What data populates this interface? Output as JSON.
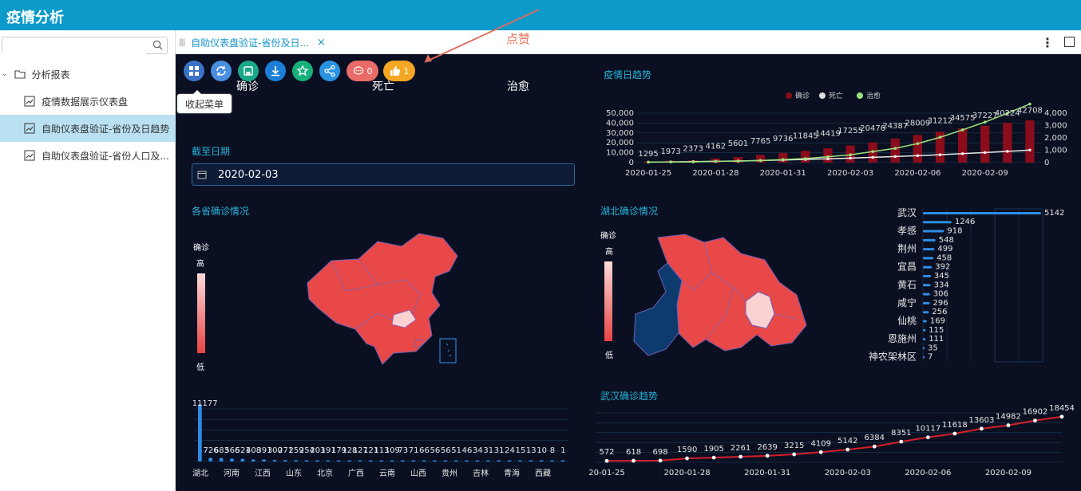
{
  "app": {
    "title": "疫情分析"
  },
  "sidebar": {
    "search_placeholder": "",
    "items": [
      {
        "label": "分析报表"
      },
      {
        "label": "疫情数据展示仪表盘"
      },
      {
        "label": "自助仪表盘验证-省份及日趋势"
      },
      {
        "label": "自助仪表盘验证-省份人口及..."
      }
    ]
  },
  "tabs": [
    {
      "label": "自助仪表盘验证-省份及日..."
    }
  ],
  "annotation": {
    "text": "点赞"
  },
  "toolbar": {
    "comment_count": "0",
    "like_count": "1",
    "tooltip": "收起菜单"
  },
  "colors": {
    "accent": "#0b9ac9",
    "dash_bg": "#0a1021",
    "title": "#27b2d8",
    "bar_red": "#8b0d1c",
    "map_red": "#e84848",
    "line_green": "#9be27c"
  },
  "kpis": {
    "confirmed": "确诊",
    "deaths": "死亡",
    "cured": "治愈"
  },
  "date_filter": {
    "label": "截至日期",
    "value": "2020-02-03"
  },
  "panels": {
    "province_map": {
      "title": "各省确诊情况",
      "legend_title": "确诊",
      "legend_high": "高",
      "legend_low": "低"
    },
    "daily_trend": {
      "title": "疫情日趋势"
    },
    "hubei_map": {
      "title": "湖北确诊情况",
      "legend_title": "确诊",
      "legend_high": "高",
      "legend_low": "低"
    },
    "wuhan_trend": {
      "title": "武汉确诊趋势"
    }
  },
  "chart_data": [
    {
      "type": "bar",
      "id": "daily_trend",
      "title": "疫情日趋势",
      "x": [
        "2020-01-25",
        "2020-01-26",
        "2020-01-27",
        "2020-01-28",
        "2020-01-29",
        "2020-01-30",
        "2020-01-31",
        "2020-02-01",
        "2020-02-02",
        "2020-02-03",
        "2020-02-04",
        "2020-02-05",
        "2020-02-06",
        "2020-02-07",
        "2020-02-08",
        "2020-02-09",
        "2020-02-10",
        "2020-02-11"
      ],
      "x_tick_labels": [
        "2020-01-25",
        "2020-01-28",
        "2020-01-31",
        "2020-02-03",
        "2020-02-06",
        "2020-02-09"
      ],
      "series": [
        {
          "name": "确诊",
          "axis": "left",
          "values": [
            1295,
            1973,
            2373,
            4162,
            5601,
            7765,
            9736,
            11845,
            14419,
            17255,
            20476,
            24387,
            28009,
            31212,
            34575,
            37227,
            40224,
            42708
          ]
        },
        {
          "name": "死亡",
          "axis": "right",
          "values": [
            41,
            56,
            80,
            106,
            132,
            170,
            213,
            259,
            304,
            361,
            425,
            490,
            563,
            636,
            722,
            811,
            908,
            1016
          ]
        },
        {
          "name": "治愈",
          "axis": "right",
          "values": [
            38,
            51,
            60,
            103,
            124,
            171,
            243,
            328,
            475,
            632,
            892,
            1153,
            1540,
            2050,
            2649,
            3281,
            3996,
            4740
          ]
        }
      ],
      "left_axis_ticks": [
        "0",
        "10,000",
        "20,000",
        "30,000",
        "40,000",
        "50,000"
      ],
      "right_axis_ticks": [
        "0",
        "1,000",
        "2,000",
        "3,000",
        "4,000"
      ],
      "ylim_left": [
        0,
        50000
      ],
      "ylim_right": [
        0,
        4000
      ],
      "visible_point_labels": [
        "1295",
        "1973",
        "2373",
        "4162",
        "5601",
        "7765",
        "9736",
        "11845",
        "14419",
        "17255",
        "20476",
        "24387",
        "28009",
        "31212",
        "34575",
        "37227",
        "40224",
        "42708",
        "6",
        "52",
        "7",
        "138",
        "11",
        "110",
        "113",
        "249",
        "89",
        "355",
        "485",
        "887",
        "863",
        "1152",
        "1531",
        "2016",
        "2613",
        "3314",
        "4620",
        "417",
        "564",
        "687",
        "780",
        "899",
        "986",
        "1014"
      ],
      "legend_position": "top"
    },
    {
      "type": "bar",
      "id": "province_bars",
      "categories": [
        "湖北",
        "",
        "河南",
        "",
        "江西",
        "",
        "山东",
        "",
        "北京",
        "",
        "广西",
        "",
        "云南",
        "",
        "山西",
        "",
        "贵州",
        "",
        "吉林",
        "",
        "青海",
        "",
        "西藏"
      ],
      "x_tick_labels": [
        "湖北",
        "河南",
        "江西",
        "山东",
        "北京",
        "广西",
        "云南",
        "山西",
        "贵州",
        "吉林",
        "青海",
        "西藏"
      ],
      "values": [
        11177,
        726,
        683,
        566,
        521,
        408,
        391,
        300,
        271,
        259,
        254,
        203,
        191,
        179,
        128,
        127,
        121,
        113,
        109,
        73,
        71,
        66,
        56,
        56,
        51,
        46,
        34,
        31,
        31,
        24,
        15,
        13,
        10,
        8,
        1
      ],
      "visible_labels": [
        "11177",
        "726",
        "683",
        "566",
        "521",
        "408",
        "391",
        "300",
        "271",
        "259",
        "254",
        "203",
        "191",
        "179",
        "128",
        "127",
        "121",
        "113",
        "109",
        "73",
        "71",
        "66",
        "56",
        "56",
        "51",
        "46",
        "34",
        "31",
        "31",
        "24",
        "15",
        "13",
        "10",
        "8",
        "1"
      ]
    },
    {
      "type": "bar",
      "id": "hubei_city_bars",
      "orientation": "horizontal",
      "categories": [
        "武汉",
        "",
        "孝感",
        "",
        "荆州",
        "",
        "宜昌",
        "",
        "黄石",
        "",
        "咸宁",
        "",
        "仙桃",
        "",
        "恩施州",
        "",
        "神农架林区"
      ],
      "visible_category_labels": [
        "武汉",
        "孝感",
        "荆州",
        "宜昌",
        "黄石",
        "咸宁",
        "仙桃",
        "恩施州",
        "神农架林区"
      ],
      "values": [
        5142,
        1246,
        918,
        548,
        499,
        458,
        392,
        345,
        334,
        306,
        296,
        256,
        169,
        115,
        111,
        35,
        7
      ]
    },
    {
      "type": "line",
      "id": "wuhan_trend",
      "title": "武汉确诊趋势",
      "x_tick_labels": [
        "20-01-25",
        "2020-01-28",
        "2020-01-31",
        "2020-02-03",
        "2020-02-06",
        "2020-02-09"
      ],
      "values": [
        572,
        618,
        698,
        1590,
        1905,
        2261,
        2639,
        3215,
        4109,
        5142,
        6384,
        8351,
        10117,
        11618,
        13603,
        14982,
        16902,
        18454
      ]
    }
  ]
}
